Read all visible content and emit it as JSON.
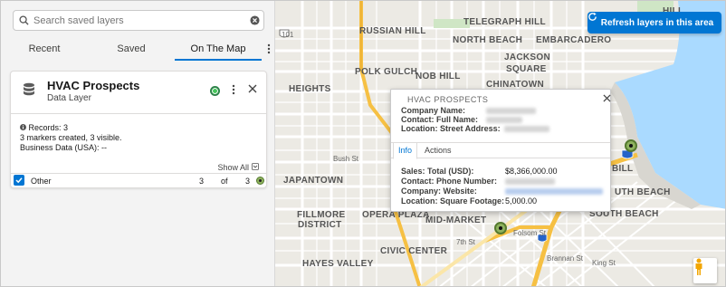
{
  "search": {
    "placeholder": "Search saved layers"
  },
  "tabs": [
    {
      "label": "Recent"
    },
    {
      "label": "Saved"
    },
    {
      "label": "On The Map"
    }
  ],
  "layer_card": {
    "title": "HVAC Prospects",
    "subtitle": "Data Layer",
    "records": "Records: 3",
    "markers": "3 markers created, 3 visible.",
    "business": "Business Data (USA): --",
    "show_all": "Show All",
    "other_label": "Other",
    "count_visible": "3",
    "of": "of",
    "count_total": "3"
  },
  "map": {
    "refresh_label": "Refresh layers in this area",
    "labels": [
      "TELEGRAPH HILL",
      "RUSSIAN HILL",
      "NORTH BEACH",
      "EMBARCADERO",
      "POLK GULCH",
      "JACKSON",
      "SQUARE",
      "NOB HILL",
      "CHINATOWN",
      "HEIGHTS",
      "JAPANTOWN",
      "FILLMORE",
      "DISTRICT",
      "OPERA PLAZA",
      "MID-MARKET",
      "CIVIC CENTER",
      "HAYES VALLEY",
      "SOUTH BEACH",
      "UTH BEACH",
      "HILL",
      "BILL"
    ],
    "streets": [
      "101",
      "101",
      "80",
      "Bush St",
      "St",
      "5th St",
      "16th St",
      "7th St",
      "8th St",
      "Folsom St",
      "Brannan St",
      "King St",
      "3rd St",
      "Mission St",
      "Market St",
      "Geary Blvd",
      "Golden Gate Ave",
      "Oak St",
      "Polk St",
      "Octavia St",
      "Divisadero St",
      "Franklin St",
      "3rd St"
    ]
  },
  "popup": {
    "title": "HVAC PROSPECTS",
    "company_name_label": "Company Name:",
    "contact_label": "Contact: Full Name:",
    "location_label": "Location: Street Address:",
    "tab_info": "Info",
    "tab_actions": "Actions",
    "sales_label": "Sales: Total (USD):",
    "sales_value": "$8,366,000.00",
    "phone_label": "Contact: Phone Number:",
    "website_label": "Company: Website:",
    "sqft_label": "Location: Square Footage:",
    "sqft_value": "5,000.00"
  },
  "colors": {
    "accent": "#0176d3",
    "marker_fill": "#8fb35f",
    "marker_border": "#557a2f",
    "highway": "#f6c043",
    "water": "#aadaff"
  },
  "icons": [
    "search-icon",
    "clear-icon",
    "kebab-icon",
    "database-icon",
    "close-icon",
    "info-icon",
    "checkbox-checked-icon",
    "refresh-icon",
    "pegman-icon",
    "collapse-icon"
  ]
}
